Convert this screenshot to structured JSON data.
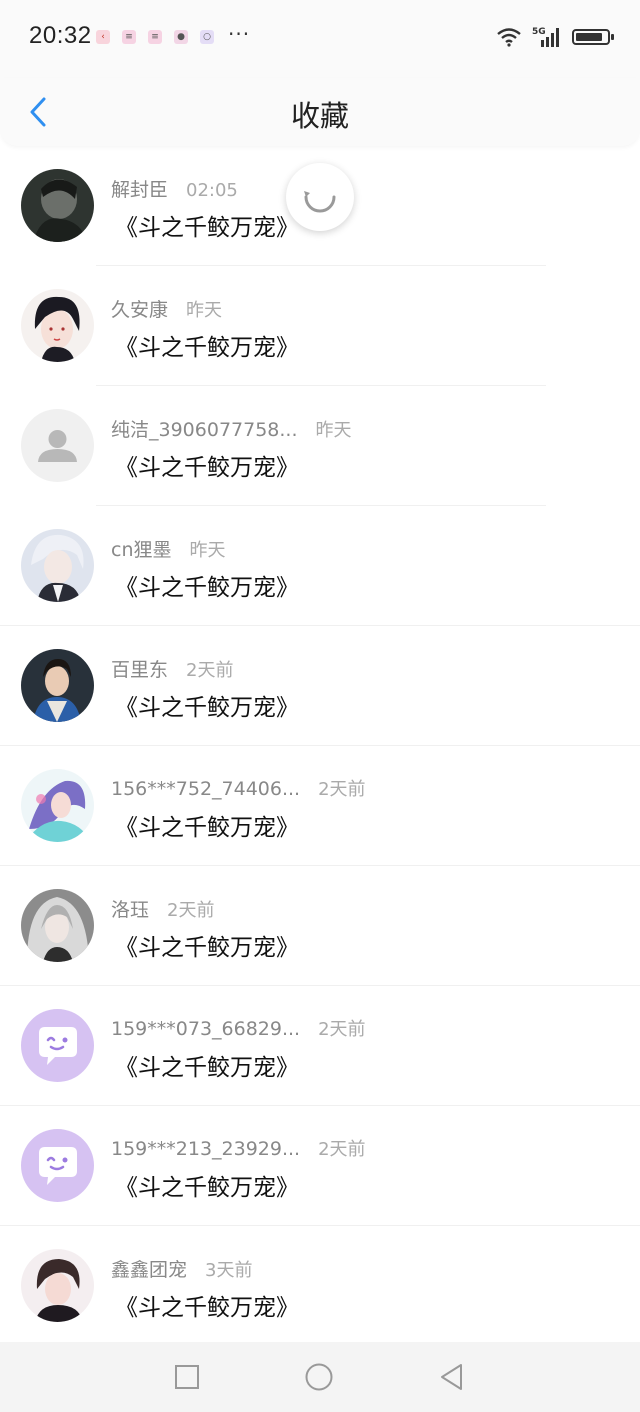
{
  "status_bar": {
    "time": "20:32",
    "notification_icons": [
      "pink-app-icon",
      "pink-app-icon",
      "pink-app-icon",
      "pink-app-icon",
      "blue-app-icon"
    ],
    "more": "···",
    "network": "5G",
    "battery_level": 0.88
  },
  "header": {
    "title": "收藏",
    "back_icon": "chevron-left-icon",
    "accent_color": "#2f8ff0"
  },
  "items": [
    {
      "name": "解封臣",
      "time": "02:05",
      "content": "《斗之千鲛万宠》",
      "avatar": "photo-dark"
    },
    {
      "name": "久安康",
      "time": "昨天",
      "content": "《斗之千鲛万宠》",
      "avatar": "anime-portrait"
    },
    {
      "name": "纯洁_3906077758...",
      "time": "昨天",
      "content": "《斗之千鲛万宠》",
      "avatar": "default-person-icon"
    },
    {
      "name": "cn狸墨",
      "time": "昨天",
      "content": "《斗之千鲛万宠》",
      "avatar": "anime-white-hair"
    },
    {
      "name": "百里东",
      "time": "2天前",
      "content": "《斗之千鲛万宠》",
      "avatar": "costume-portrait"
    },
    {
      "name": "156***752_74406...",
      "time": "2天前",
      "content": "《斗之千鲛万宠》",
      "avatar": "anime-colorful"
    },
    {
      "name": "洛珏",
      "time": "2天前",
      "content": "《斗之千鲛万宠》",
      "avatar": "anime-gray-hair"
    },
    {
      "name": "159***073_66829...",
      "time": "2天前",
      "content": "《斗之千鲛万宠》",
      "avatar": "chat-bubble-face-icon"
    },
    {
      "name": "159***213_23929...",
      "time": "2天前",
      "content": "《斗之千鲛万宠》",
      "avatar": "chat-bubble-face-icon"
    },
    {
      "name": "鑫鑫团宠",
      "time": "3天前",
      "content": "《斗之千鲛万宠》",
      "avatar": "photo-portrait"
    }
  ],
  "loading": {
    "icon": "refresh-spinner-icon"
  },
  "nav_bar": {
    "buttons": [
      "square-recents-icon",
      "circle-home-icon",
      "triangle-back-icon"
    ]
  }
}
